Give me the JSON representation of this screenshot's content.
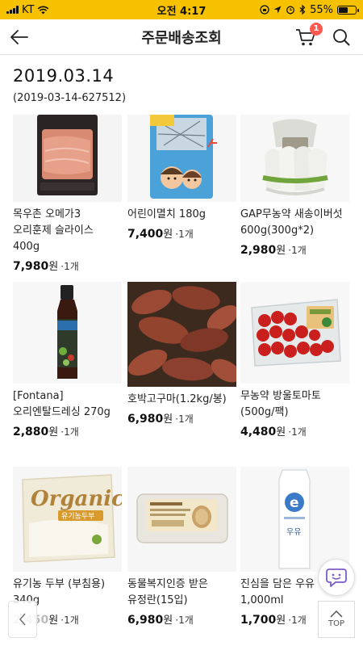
{
  "status_bar": {
    "carrier": "KT",
    "time": "오전 4:17",
    "battery": "55%",
    "battery_level": 0.55,
    "icons": [
      "signal-icon",
      "wifi-icon",
      "rotation-lock-icon",
      "location-icon",
      "alarm-icon",
      "bluetooth-icon",
      "battery-icon"
    ]
  },
  "nav": {
    "title": "주문배송조회",
    "cart_count": "1",
    "icons": [
      "back-arrow-icon",
      "cart-icon",
      "search-icon"
    ]
  },
  "order": {
    "date": "2019.03.14",
    "number": "(2019-03-14-627512)"
  },
  "products": [
    {
      "name": "목우촌 오메가3 오리훈제 슬라이스 400g",
      "price": "7,980",
      "won": "원",
      "qty": "·1개",
      "image": "smoked-duck-pack"
    },
    {
      "name": "어린이멸치 180g",
      "price": "7,400",
      "won": "원",
      "qty": "·1개",
      "image": "kids-anchovy-bag"
    },
    {
      "name": "GAP무농약 새송이버섯 600g(300g*2)",
      "price": "2,980",
      "won": "원",
      "qty": "·1개",
      "image": "king-oyster-mushroom"
    },
    {
      "name": "[Fontana] 오리엔탈드레싱 270g",
      "price": "2,880",
      "won": "원",
      "qty": "·1개",
      "image": "dressing-bottle"
    },
    {
      "name": "호박고구마(1.2kg/봉)",
      "price": "6,980",
      "won": "원",
      "qty": "·1개",
      "image": "sweet-potatoes"
    },
    {
      "name": "무농약 방울토마토(500g/팩)",
      "price": "4,480",
      "won": "원",
      "qty": "·1개",
      "image": "cherry-tomato-pack"
    },
    {
      "name": "유기농 두부 (부침용) 340g",
      "price": "2,450",
      "won": "원",
      "qty": "·1개",
      "image": "organic-tofu"
    },
    {
      "name": "동물복지인증 받은 유정란(15입)",
      "price": "6,980",
      "won": "원",
      "qty": "·1개",
      "image": "egg-carton"
    },
    {
      "name": "진심을 담은 우유 1,000ml",
      "price": "1,700",
      "won": "원",
      "qty": "·1개",
      "image": "milk-carton"
    }
  ],
  "image_text": {
    "tofu_brand": "Organic",
    "tofu_label": "유기농두부",
    "milk_letter": "e",
    "milk_label": "우유"
  },
  "floating": {
    "top_label": "TOP",
    "icons": [
      "chat-icon",
      "chevron-up-icon",
      "chevron-left-icon"
    ]
  },
  "colors": {
    "status_bar": "#f6c200",
    "badge": "#ff5a4f",
    "chat_icon": "#7a5cc8"
  }
}
